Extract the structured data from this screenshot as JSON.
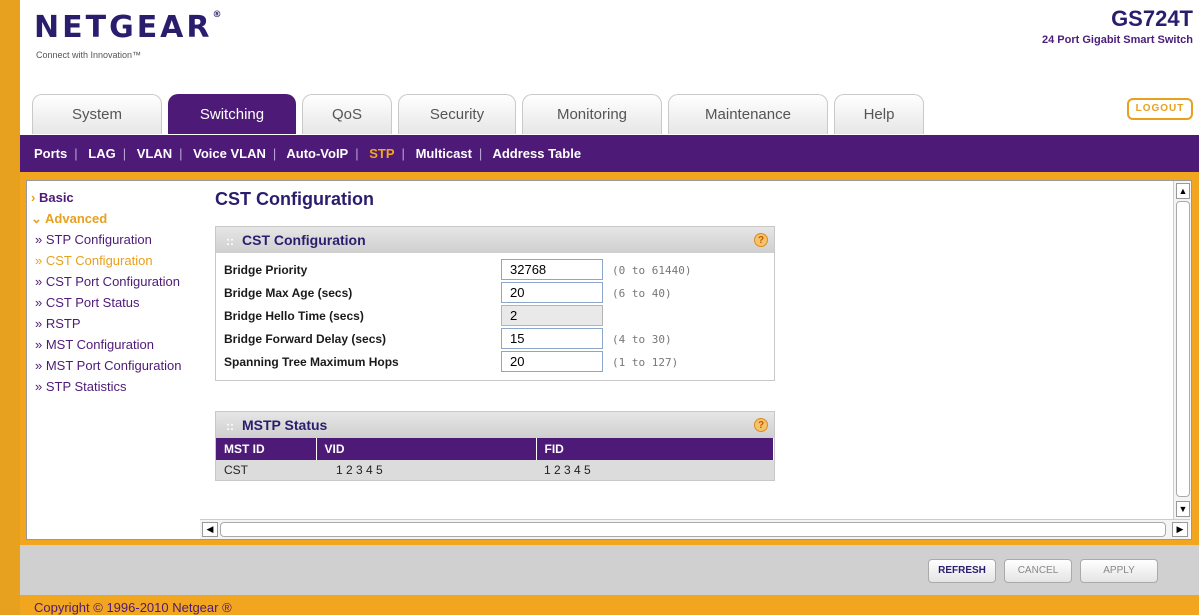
{
  "brand": {
    "logo": "NETGEAR",
    "tagline": "Connect with Innovation™",
    "model": "GS724T",
    "model_desc": "24 Port Gigabit Smart Switch"
  },
  "tabs": [
    {
      "label": "System"
    },
    {
      "label": "Switching"
    },
    {
      "label": "QoS"
    },
    {
      "label": "Security"
    },
    {
      "label": "Monitoring"
    },
    {
      "label": "Maintenance"
    },
    {
      "label": "Help"
    }
  ],
  "active_tab": "Switching",
  "logout_label": "LOGOUT",
  "subnav": [
    "Ports",
    "LAG",
    "VLAN",
    "Voice VLAN",
    "Auto-VoIP",
    "STP",
    "Multicast",
    "Address Table"
  ],
  "subnav_current": "STP",
  "sidebar": {
    "basic": "Basic",
    "advanced": "Advanced",
    "items": [
      "STP Configuration",
      "CST Configuration",
      "CST Port Configuration",
      "CST Port Status",
      "RSTP",
      "MST Configuration",
      "MST Port Configuration",
      "STP Statistics"
    ],
    "current": "CST Configuration"
  },
  "page_title": "CST Configuration",
  "cst_box": {
    "title": "CST Configuration",
    "fields": [
      {
        "label": "Bridge Priority",
        "value": "32768",
        "range": "(0 to 61440)",
        "readonly": false
      },
      {
        "label": "Bridge Max Age (secs)",
        "value": "20",
        "range": "(6 to 40)",
        "readonly": false
      },
      {
        "label": "Bridge Hello Time (secs)",
        "value": "2",
        "range": "",
        "readonly": true
      },
      {
        "label": "Bridge Forward Delay (secs)",
        "value": "15",
        "range": "(4 to 30)",
        "readonly": false
      },
      {
        "label": "Spanning Tree Maximum Hops",
        "value": "20",
        "range": "(1 to 127)",
        "readonly": false
      }
    ]
  },
  "mstp_box": {
    "title": "MSTP Status",
    "columns": [
      "MST ID",
      "VID",
      "FID"
    ],
    "rows": [
      [
        "CST",
        "1 2 3 4 5",
        "1 2 3 4 5"
      ]
    ]
  },
  "buttons": {
    "refresh": "REFRESH",
    "cancel": "CANCEL",
    "apply": "APPLY"
  },
  "copyright": "Copyright © 1996-2010 Netgear ®",
  "colors": {
    "purple": "#4e1a78",
    "orange": "#e8a01f",
    "navy": "#2b1d6e"
  }
}
